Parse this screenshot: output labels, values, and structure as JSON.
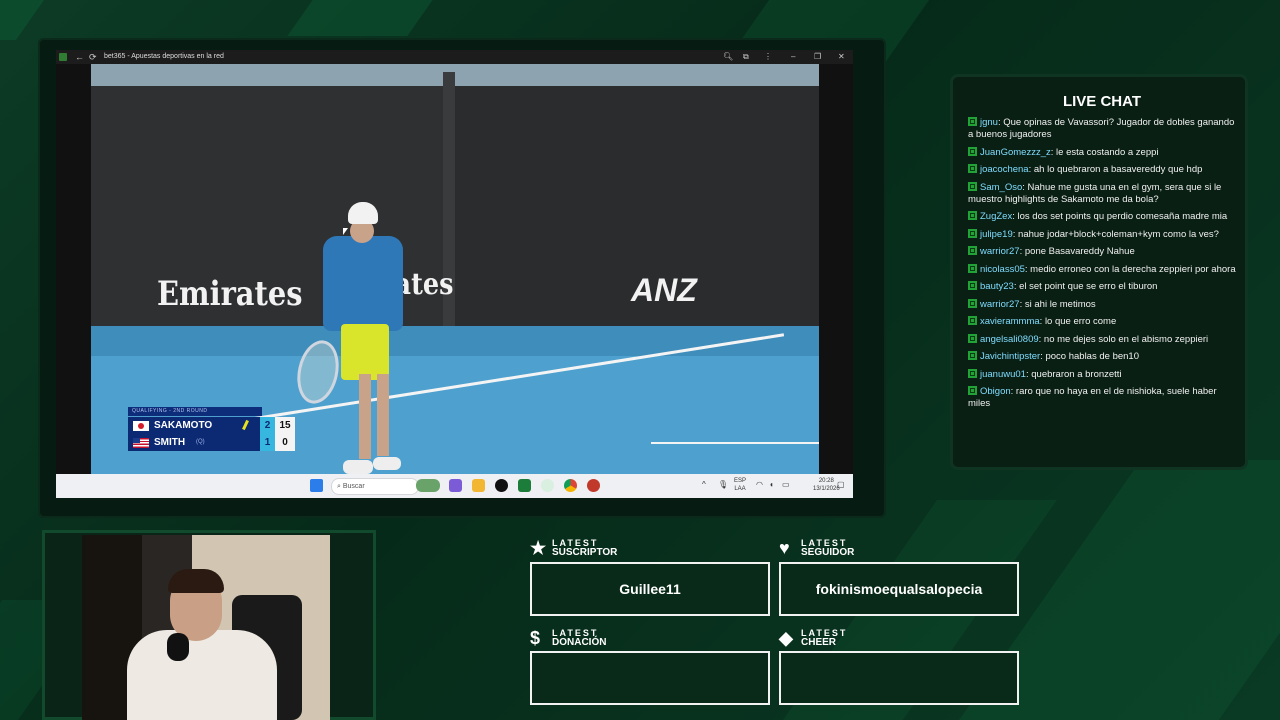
{
  "browser": {
    "tab_title": "bet365 - Apuestas deportivas en la red",
    "controls": [
      "–",
      "❐",
      "✕"
    ]
  },
  "video": {
    "sponsors": [
      "Emirates",
      "Emirates",
      "ANZ"
    ],
    "scoreboard": {
      "round": "QUALIFYING - 2ND ROUND",
      "players": [
        {
          "name": "SAKAMOTO",
          "flag": "JPN",
          "sets": "2",
          "points": "15",
          "serving": true,
          "extra": ""
        },
        {
          "name": "SMITH",
          "flag": "USA",
          "sets": "1",
          "points": "0",
          "serving": false,
          "extra": "(Q)"
        }
      ]
    }
  },
  "taskbar": {
    "search_placeholder": "Buscar",
    "language": "ESP",
    "language_sub": "LAA",
    "time": "20:28",
    "date": "13/1/2026"
  },
  "chat": {
    "title": "LIVE CHAT",
    "messages": [
      {
        "user": "jgnu",
        "text": "Que opinas de Vavassori? Jugador de dobles ganando a buenos jugadores"
      },
      {
        "user": "JuanGomezzz_z",
        "text": "le esta costando a zeppi"
      },
      {
        "user": "joacochena",
        "text": "ah lo quebraron a basavereddy que hdp"
      },
      {
        "user": "Sam_Oso",
        "text": "Nahue me gusta una en el gym, sera que si le muestro highlights de Sakamoto me da bola?"
      },
      {
        "user": "ZugZex",
        "text": "los dos set points qu perdio comesaña madre mia"
      },
      {
        "user": "julipe19",
        "text": "nahue jodar+block+coleman+kym como la ves?"
      },
      {
        "user": "warrior27",
        "text": "pone Basavareddy Nahue"
      },
      {
        "user": "nicolass05",
        "text": "medio erroneo con la derecha zeppieri por ahora"
      },
      {
        "user": "bauty23",
        "text": "el set point que se erro el tiburon"
      },
      {
        "user": "warrior27",
        "text": "si ahi le metimos"
      },
      {
        "user": "xavierammma",
        "text": "lo que erro come"
      },
      {
        "user": "angelsali0809",
        "text": "no me dejes solo en el abismo zeppieri"
      },
      {
        "user": "Javichintipster",
        "text": "poco hablas de ben10"
      },
      {
        "user": "juanuwu01",
        "text": "quebraron a bronzetti"
      },
      {
        "user": "Obigon",
        "text": "raro que no haya en el de nishioka, suele haber miles"
      }
    ]
  },
  "latest": {
    "suscriptor": {
      "small": "LATEST",
      "big": "SUSCRIPTOR",
      "value": "Guillee11",
      "icon": "star-icon"
    },
    "seguidor": {
      "small": "LATEST",
      "big": "SEGUIDOR",
      "value": "fokinismoequalsalopecia",
      "icon": "heart-icon"
    },
    "donacion": {
      "small": "LATEST",
      "big": "DONACIÓN",
      "value": "",
      "icon": "dollar-icon"
    },
    "cheer": {
      "small": "LATEST",
      "big": "CHEER",
      "value": "",
      "icon": "diamond-icon"
    }
  },
  "colors": {
    "background": "#0c3b25",
    "accent": "#21a338",
    "chat_user": "#7fdcff"
  }
}
